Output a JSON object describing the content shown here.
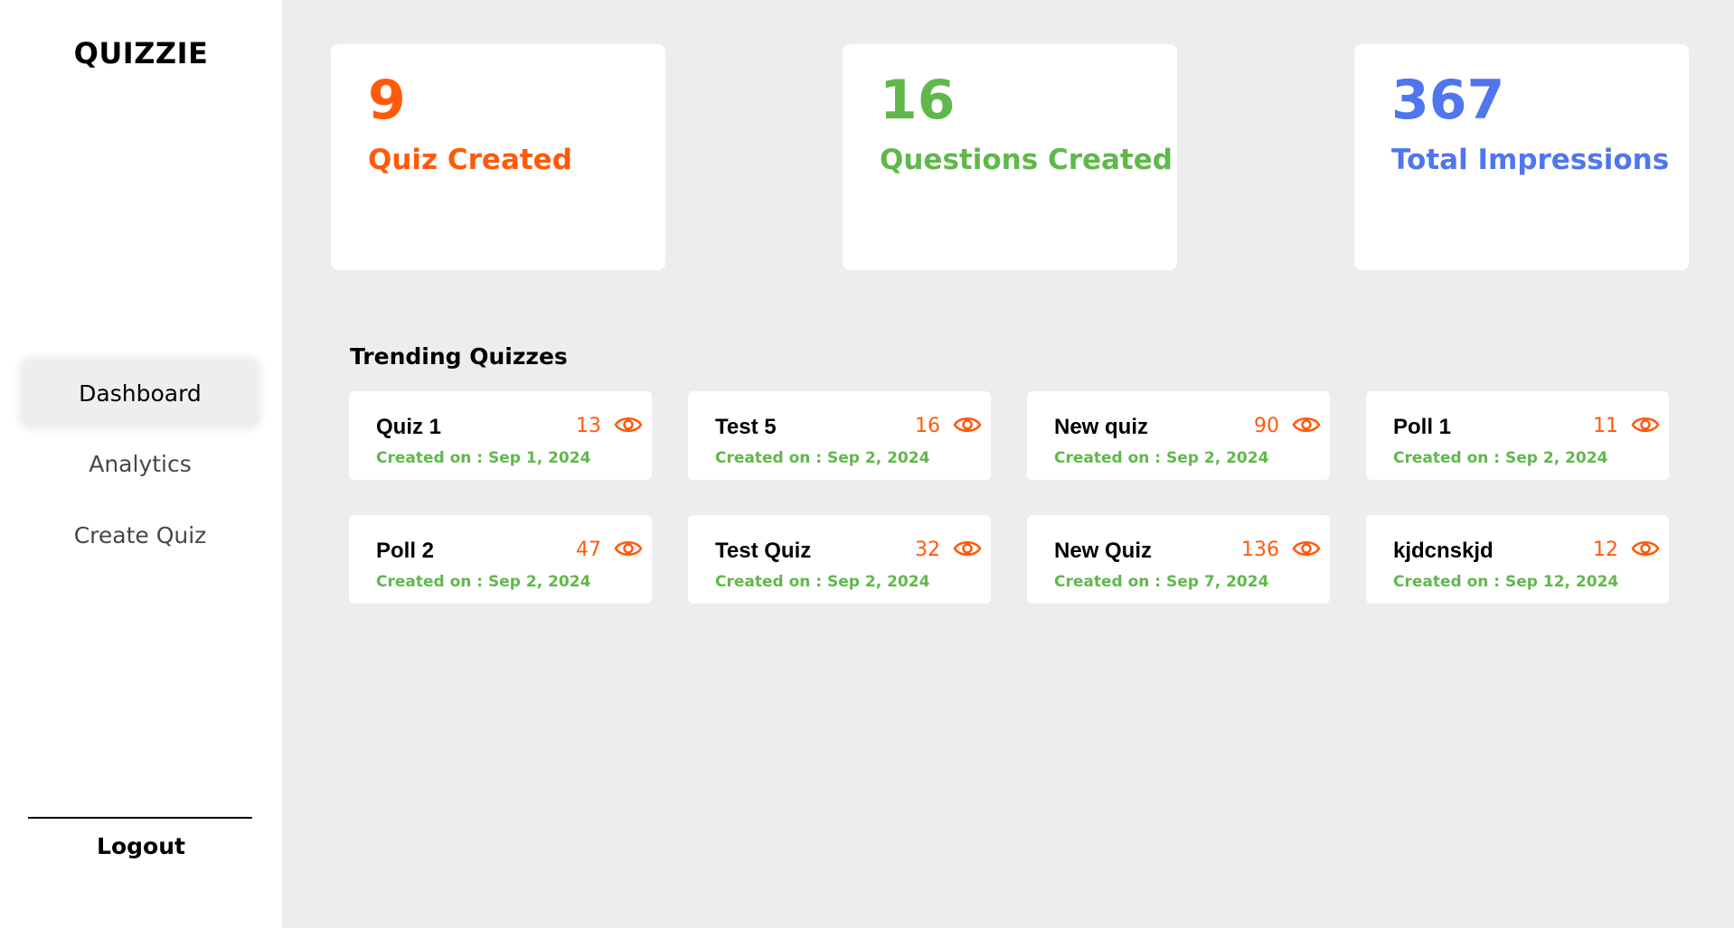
{
  "app": {
    "logo": "QUIZZIE"
  },
  "sidebar": {
    "items": [
      {
        "label": "Dashboard",
        "active": true
      },
      {
        "label": "Analytics",
        "active": false
      },
      {
        "label": "Create Quiz",
        "active": false
      }
    ],
    "logout_label": "Logout"
  },
  "stats": [
    {
      "value": "9",
      "label": "Quiz Created",
      "color": "#ff5a0a"
    },
    {
      "value": "16",
      "label": "Questions Created",
      "color": "#60b84b"
    },
    {
      "value": "367",
      "label": "Total Impressions",
      "color": "#5076ee"
    }
  ],
  "trending": {
    "title": "Trending Quizzes",
    "quizzes": [
      {
        "name": "Quiz 1",
        "impressions": "13",
        "created": "Created on : Sep 1, 2024"
      },
      {
        "name": "Test 5",
        "impressions": "16",
        "created": "Created on : Sep 2, 2024"
      },
      {
        "name": "New quiz",
        "impressions": "90",
        "created": "Created on : Sep 2, 2024"
      },
      {
        "name": "Poll 1",
        "impressions": "11",
        "created": "Created on : Sep 2, 2024"
      },
      {
        "name": "Poll 2",
        "impressions": "47",
        "created": "Created on : Sep 2, 2024"
      },
      {
        "name": "Test Quiz",
        "impressions": "32",
        "created": "Created on : Sep 2, 2024"
      },
      {
        "name": "New Quiz",
        "impressions": "136",
        "created": "Created on : Sep 7, 2024"
      },
      {
        "name": "kjdcnskjd",
        "impressions": "12",
        "created": "Created on : Sep 12, 2024"
      }
    ]
  },
  "icons": {
    "impressions": "eye-icon"
  },
  "colors": {
    "accent_orange": "#ff5a0a",
    "accent_green": "#60b84b",
    "accent_blue": "#5076ee"
  }
}
